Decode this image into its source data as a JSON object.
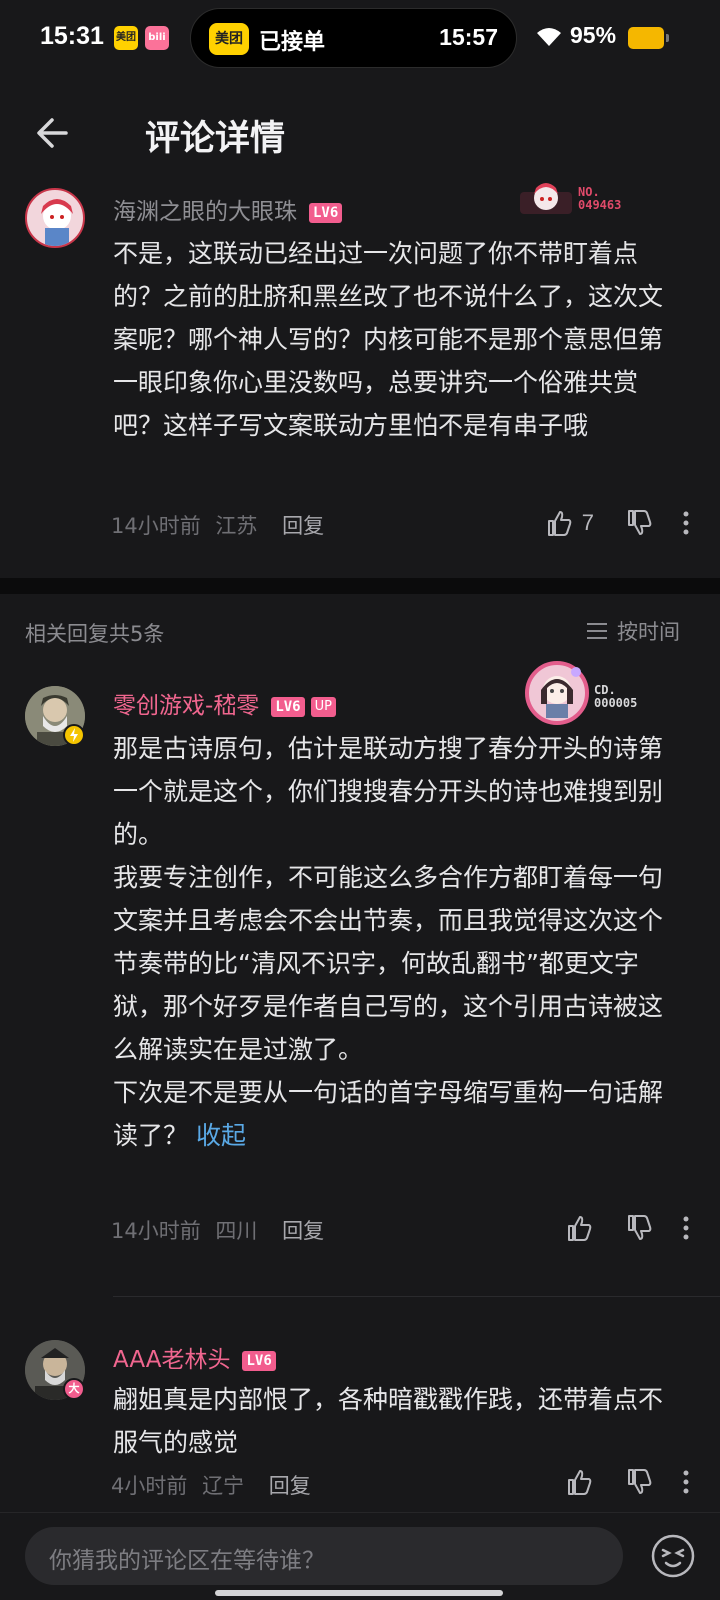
{
  "status_bar": {
    "time": "15:31",
    "app_icons": [
      "美团",
      "bili"
    ],
    "island_logo": "美团",
    "island_status": "已接单",
    "island_eta": "15:57",
    "battery": "95%"
  },
  "header": {
    "title": "评论详情"
  },
  "root_comment": {
    "user": "海渊之眼的大眼珠",
    "level": "LV6",
    "badge_no_label": "NO.",
    "badge_no_value": "049463",
    "text": "不是，这联动已经出过一次问题了你不带盯着点的？之前的肚脐和黑丝改了也不说什么了，这次文案呢？哪个神人写的？内核可能不是那个意思但第一眼印象你心里没数吗，总要讲究一个俗雅共赏吧？这样子写文案联动方里怕不是有串子哦",
    "time": "14小时前",
    "location": "江苏",
    "reply_label": "回复",
    "likes": "7"
  },
  "replies_header": {
    "count_label": "相关回复共5条",
    "sort_label": "按时间"
  },
  "replies": [
    {
      "user": "零创游戏-嵇零",
      "level": "LV6",
      "up_badge": "UP",
      "badge_no_label": "CD.",
      "badge_no_value": "000005",
      "text": "那是古诗原句，估计是联动方搜了春分开头的诗第一个就是这个，你们搜搜春分开头的诗也难搜到别的。\n我要专注创作，不可能这么多合作方都盯着每一句文案并且考虑会不会出节奏，而且我觉得这次这个节奏带的比“清风不识字，何故乱翻书”都更文字狱，那个好歹是作者自己写的，这个引用古诗被这么解读实在是过激了。\n下次是不是要从一句话的首字母缩写重构一句话解读了？",
      "collapse": "收起",
      "time": "14小时前",
      "location": "四川",
      "reply_label": "回复"
    },
    {
      "user": "AAA老林头",
      "level": "LV6",
      "avatar_badge": "大",
      "text": "翩姐真是内部恨了，各种暗戳戳作践，还带着点不服气的感觉",
      "time": "4小时前",
      "location": "辽宁",
      "reply_label": "回复"
    }
  ],
  "bottom_bar": {
    "placeholder": "你猜我的评论区在等待谁？"
  },
  "colors": {
    "accent_pink": "#f25d8e",
    "link_blue": "#5aa9e6",
    "background": "#18181a"
  }
}
